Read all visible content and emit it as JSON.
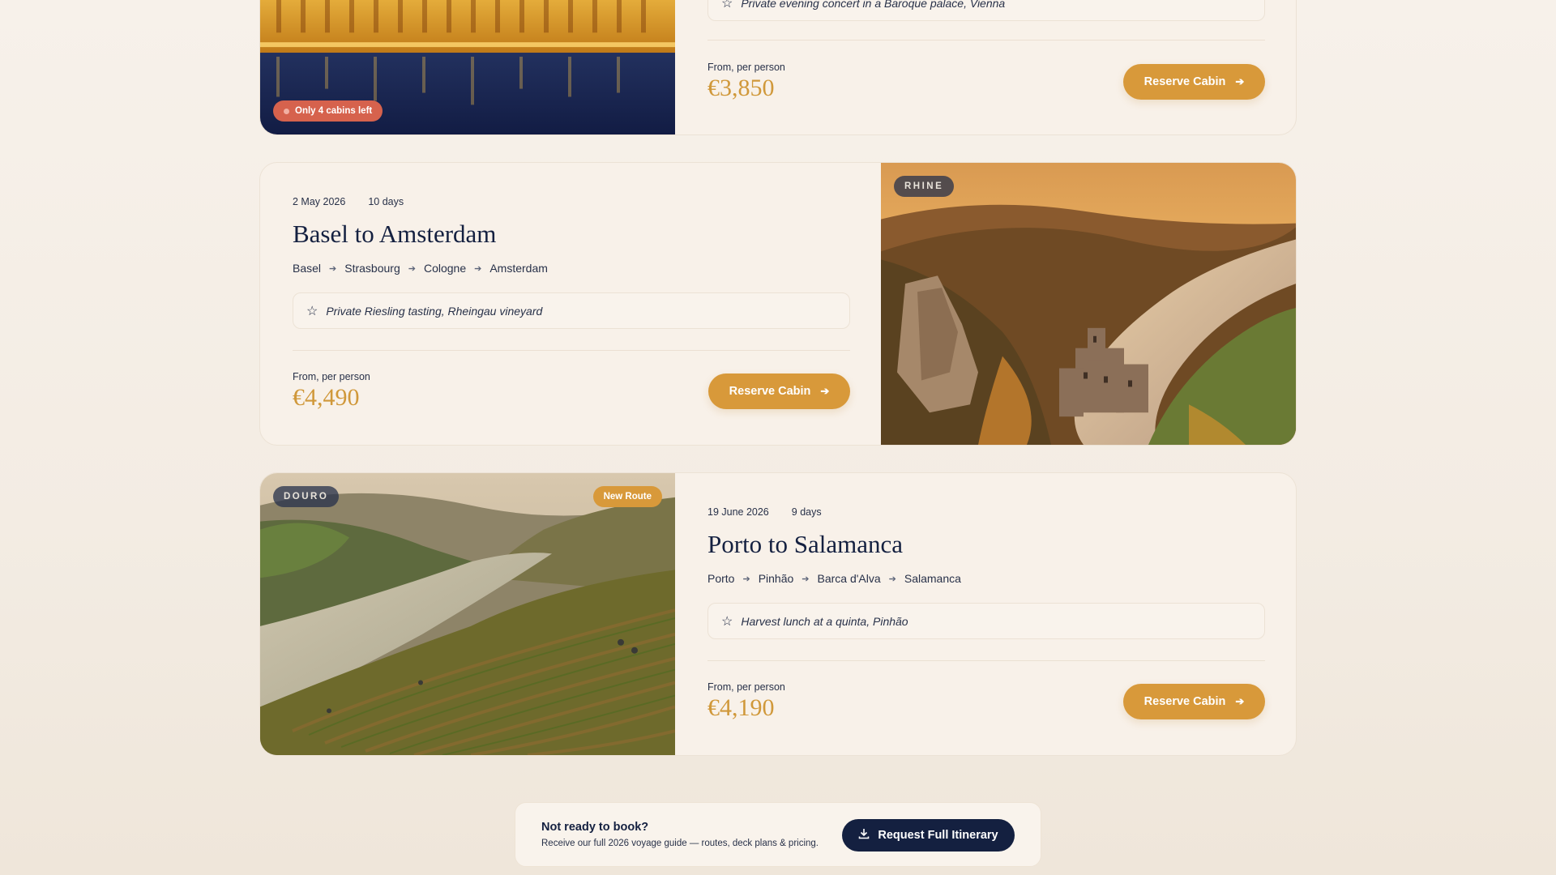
{
  "voyages": [
    {
      "highlight": "Private evening concert in a Baroque palace, Vienna",
      "price_label": "From, per person",
      "price": "€3,850",
      "button_label": "Reserve Cabin",
      "badge": "Only 4 cabins left"
    },
    {
      "date": "2 May 2026",
      "duration": "10 days",
      "title": "Basel to Amsterdam",
      "stops": [
        "Basel",
        "Strasbourg",
        "Cologne",
        "Amsterdam"
      ],
      "highlight": "Private Riesling tasting, Rheingau vineyard",
      "price_label": "From, per person",
      "price": "€4,490",
      "button_label": "Reserve Cabin",
      "region": "RHINE"
    },
    {
      "date": "19 June 2026",
      "duration": "9 days",
      "title": "Porto to Salamanca",
      "stops": [
        "Porto",
        "Pinhão",
        "Barca d'Alva",
        "Salamanca"
      ],
      "highlight": "Harvest lunch at a quinta, Pinhão",
      "price_label": "From, per person",
      "price": "€4,190",
      "button_label": "Reserve Cabin",
      "region": "DOURO",
      "badge": "New Route"
    }
  ],
  "cta": {
    "title": "Not ready to book?",
    "subtitle": "Receive our full 2026 voyage guide — routes, deck plans & pricing.",
    "button_label": "Request Full Itinerary"
  },
  "icons": {
    "star": "star-icon",
    "arrow": "arrow-right-icon",
    "download": "download-icon"
  },
  "colors": {
    "accent": "#d8993a",
    "navy": "#142040",
    "urgent": "#d6624d",
    "background": "#f6efe6"
  }
}
